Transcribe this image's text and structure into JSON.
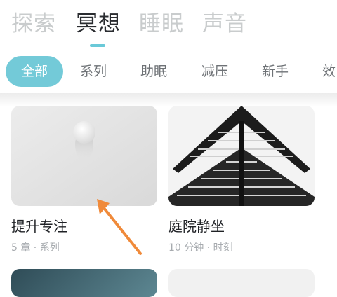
{
  "top_tabs": [
    {
      "label": "探索",
      "active": false
    },
    {
      "label": "冥想",
      "active": true
    },
    {
      "label": "睡眠",
      "active": false
    },
    {
      "label": "声音",
      "active": false
    }
  ],
  "filters": [
    {
      "label": "全部",
      "active": true
    },
    {
      "label": "系列",
      "active": false
    },
    {
      "label": "助眠",
      "active": false
    },
    {
      "label": "减压",
      "active": false
    },
    {
      "label": "新手",
      "active": false
    },
    {
      "label": "效",
      "active": false
    }
  ],
  "cards": [
    {
      "title": "提升专注",
      "meta": "5 章 · 系列",
      "image": "white-sphere-on-gray"
    },
    {
      "title": "庭院静坐",
      "meta": "10 分钟 · 时刻",
      "image": "pagoda-roof-eaves"
    }
  ],
  "colors": {
    "accent": "#73cad8",
    "indicator": "#6ac9d8",
    "annotation_arrow": "#f08a3a",
    "inactive_tab": "#c9cccd",
    "active_tab": "#2a2c30"
  }
}
